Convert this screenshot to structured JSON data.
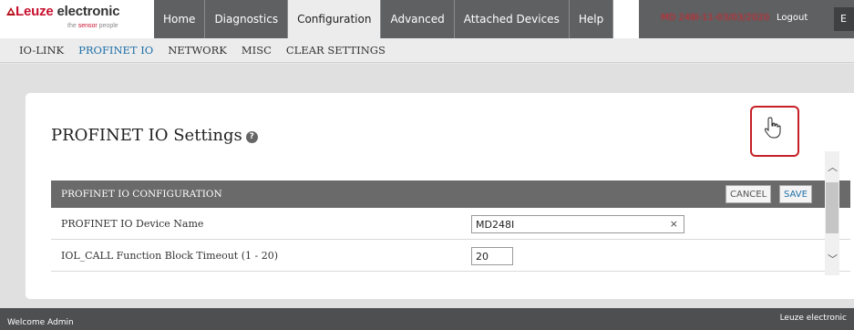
{
  "logo": {
    "brand_red": "Leuze",
    "brand_rest": " electronic",
    "tagline_prefix": "the ",
    "tagline_red": "sensor",
    "tagline_suffix": " people"
  },
  "main_nav": {
    "tabs": [
      "Home",
      "Diagnostics",
      "Configuration",
      "Advanced",
      "Attached Devices",
      "Help"
    ],
    "active": "Configuration"
  },
  "user_tools": {
    "status_text": "MD 248I-11-03/03/2020",
    "logout_label": "Logout",
    "language_label": "E"
  },
  "sub_nav": {
    "items": [
      "IO-LINK",
      "PROFINET IO",
      "NETWORK",
      "MISC",
      "CLEAR SETTINGS"
    ],
    "active": "PROFINET IO"
  },
  "page": {
    "title": "PROFINET IO Settings",
    "help_icon": "question-circle-icon"
  },
  "config": {
    "header_label": "PROFINET IO CONFIGURATION",
    "cancel_label": "CANCEL",
    "save_label": "SAVE",
    "rows": [
      {
        "name": "PROFINET IO Device Name",
        "value": "MD248I"
      },
      {
        "name": "IOL_CALL Function Block Timeout (1 - 20)",
        "value": "20"
      }
    ]
  },
  "footer": {
    "welcome": "Welcome Admin",
    "brand": "Leuze electronic"
  },
  "colors": {
    "brand_red": "#c8102e",
    "nav_gray": "#5f6062",
    "active_link": "#1e6fa8",
    "highlight": "#c61f25"
  }
}
